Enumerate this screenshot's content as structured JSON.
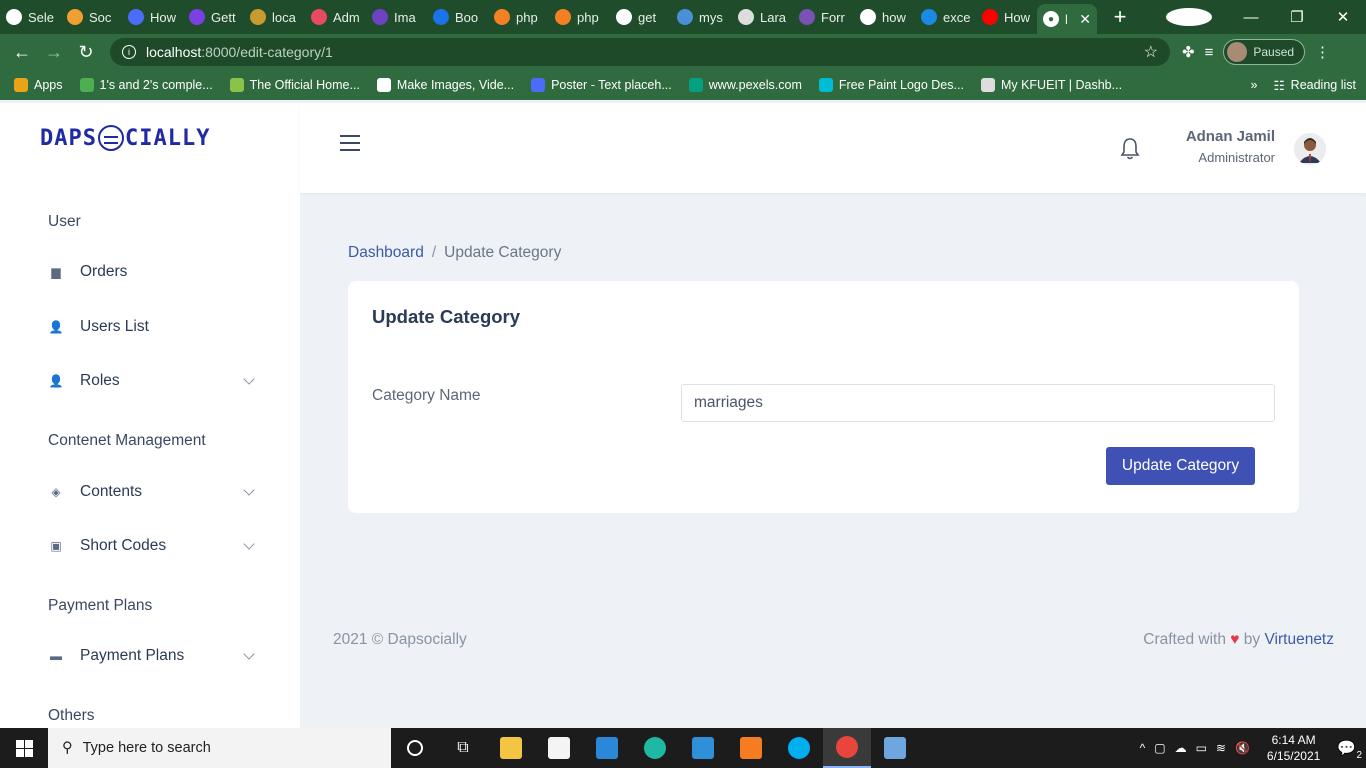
{
  "browser": {
    "tabs": [
      {
        "label": "Sele",
        "color": "#ffffff"
      },
      {
        "label": "Soc",
        "color": "#f0a030"
      },
      {
        "label": "How",
        "color": "#4a6cf7"
      },
      {
        "label": "Gett",
        "color": "#7b3fe4"
      },
      {
        "label": "loca",
        "color": "#c99a2e"
      },
      {
        "label": "Adm",
        "color": "#e84a5f"
      },
      {
        "label": "Ima",
        "color": "#6f42c1"
      },
      {
        "label": "Boo",
        "color": "#1a73e8"
      },
      {
        "label": "php",
        "color": "#f48024"
      },
      {
        "label": "php",
        "color": "#f48024"
      },
      {
        "label": "get",
        "color": "#ffffff"
      },
      {
        "label": "mys",
        "color": "#4a90d9"
      },
      {
        "label": "Lara",
        "color": "#dddddd"
      },
      {
        "label": "Forr",
        "color": "#7952b3"
      },
      {
        "label": "how",
        "color": "#ffffff"
      },
      {
        "label": "exce",
        "color": "#1e88e5"
      },
      {
        "label": "How",
        "color": "#ff0000"
      }
    ],
    "active_tab_label": "l",
    "new_tab": "+",
    "url_host": "localhost",
    "url_path": ":8000/edit-category/1",
    "profile_status": "Paused",
    "bookmarks": [
      {
        "label": "Apps",
        "color": "#e8a317"
      },
      {
        "label": "1's and 2's comple...",
        "color": "#4caf50"
      },
      {
        "label": "The Official Home...",
        "color": "#8bc34a"
      },
      {
        "label": "Make Images, Vide...",
        "color": "#ffffff"
      },
      {
        "label": "Poster - Text placeh...",
        "color": "#4a6cf7"
      },
      {
        "label": "www.pexels.com",
        "color": "#05a081"
      },
      {
        "label": "Free Paint Logo Des...",
        "color": "#00bcd4"
      },
      {
        "label": "My KFUEIT | Dashb...",
        "color": "#dddddd"
      }
    ],
    "bookmarks_more": "»",
    "reading_list": "Reading list"
  },
  "sidebar": {
    "brand_left": "DAPS",
    "brand_right": "CIALLY",
    "section_user": "User",
    "orders": "Orders",
    "users_list": "Users List",
    "roles": "Roles",
    "section_content": "Contenet Management",
    "contents": "Contents",
    "short_codes": "Short Codes",
    "section_payment": "Payment Plans",
    "payment_plans": "Payment Plans",
    "section_others": "Others"
  },
  "header": {
    "user_name": "Adnan Jamil",
    "user_role": "Administrator"
  },
  "main": {
    "breadcrumb_home": "Dashboard",
    "breadcrumb_sep": "/",
    "breadcrumb_current": "Update Category",
    "card_title": "Update Category",
    "field_label": "Category Name",
    "field_value": "marriages",
    "submit_label": "Update Category"
  },
  "footer": {
    "copyright": "2021 © Dapsocially",
    "crafted": "Crafted with",
    "by": "by",
    "brand": "Virtuenetz"
  },
  "taskbar": {
    "search_placeholder": "Type here to search",
    "time": "6:14 AM",
    "date": "6/15/2021",
    "notification_count": "2",
    "apps": [
      {
        "name": "file-explorer",
        "color": "#f4c542"
      },
      {
        "name": "microsoft-store",
        "color": "#f4f4f4"
      },
      {
        "name": "mail",
        "color": "#2b88d8"
      },
      {
        "name": "edge",
        "color": "#1fb8a5"
      },
      {
        "name": "vscode",
        "color": "#2f8fd9"
      },
      {
        "name": "xampp",
        "color": "#f57c20"
      },
      {
        "name": "skype",
        "color": "#00aff0"
      },
      {
        "name": "chrome",
        "color": "#e8453c"
      },
      {
        "name": "document-viewer",
        "color": "#6ea6e0"
      }
    ]
  }
}
